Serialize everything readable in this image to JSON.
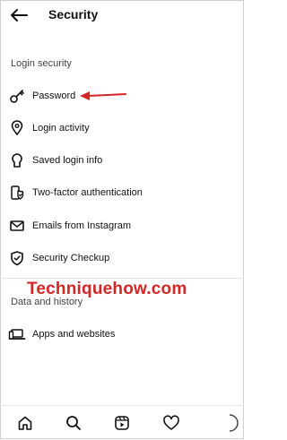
{
  "header": {
    "title": "Security",
    "back_icon": "back-arrow-icon"
  },
  "sections": {
    "login_security": "Login security",
    "data_history": "Data and history"
  },
  "items": [
    {
      "label": "Password",
      "icon": "key-icon"
    },
    {
      "label": "Login activity",
      "icon": "location-pin-icon"
    },
    {
      "label": "Saved login info",
      "icon": "keyhole-icon"
    },
    {
      "label": "Two-factor authentication",
      "icon": "shield-phone-icon"
    },
    {
      "label": "Emails from Instagram",
      "icon": "mail-icon"
    },
    {
      "label": "Security Checkup",
      "icon": "shield-check-icon"
    },
    {
      "label": "Apps and websites",
      "icon": "laptop-icon"
    }
  ],
  "watermark": "Techniquehow.com",
  "colors": {
    "annotation_red": "#d42626",
    "text": "#111111"
  },
  "bottom_nav": [
    "home-icon",
    "search-icon",
    "reels-icon",
    "heart-icon"
  ]
}
